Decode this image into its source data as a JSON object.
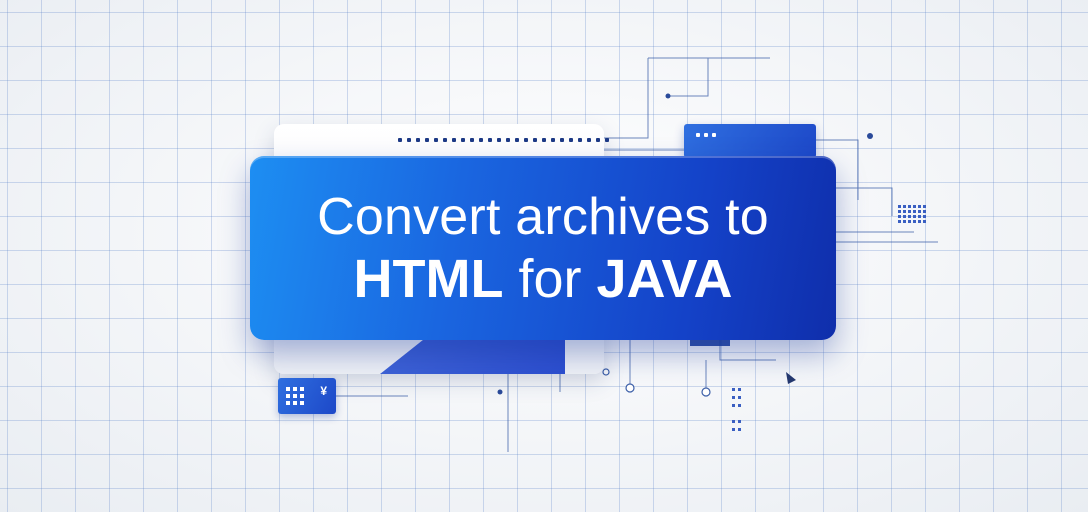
{
  "banner": {
    "line1": "Convert archives to",
    "line2_bold_a": "HTML",
    "line2_normal": " for ",
    "line2_bold_b": "JAVA"
  },
  "colors": {
    "banner_gradient_start": "#1d8ef2",
    "banner_gradient_end": "#0f2eab",
    "grid_line": "#5a82c8",
    "background": "#f4f6f9"
  },
  "icons": {
    "chip_glyph": "¥"
  }
}
